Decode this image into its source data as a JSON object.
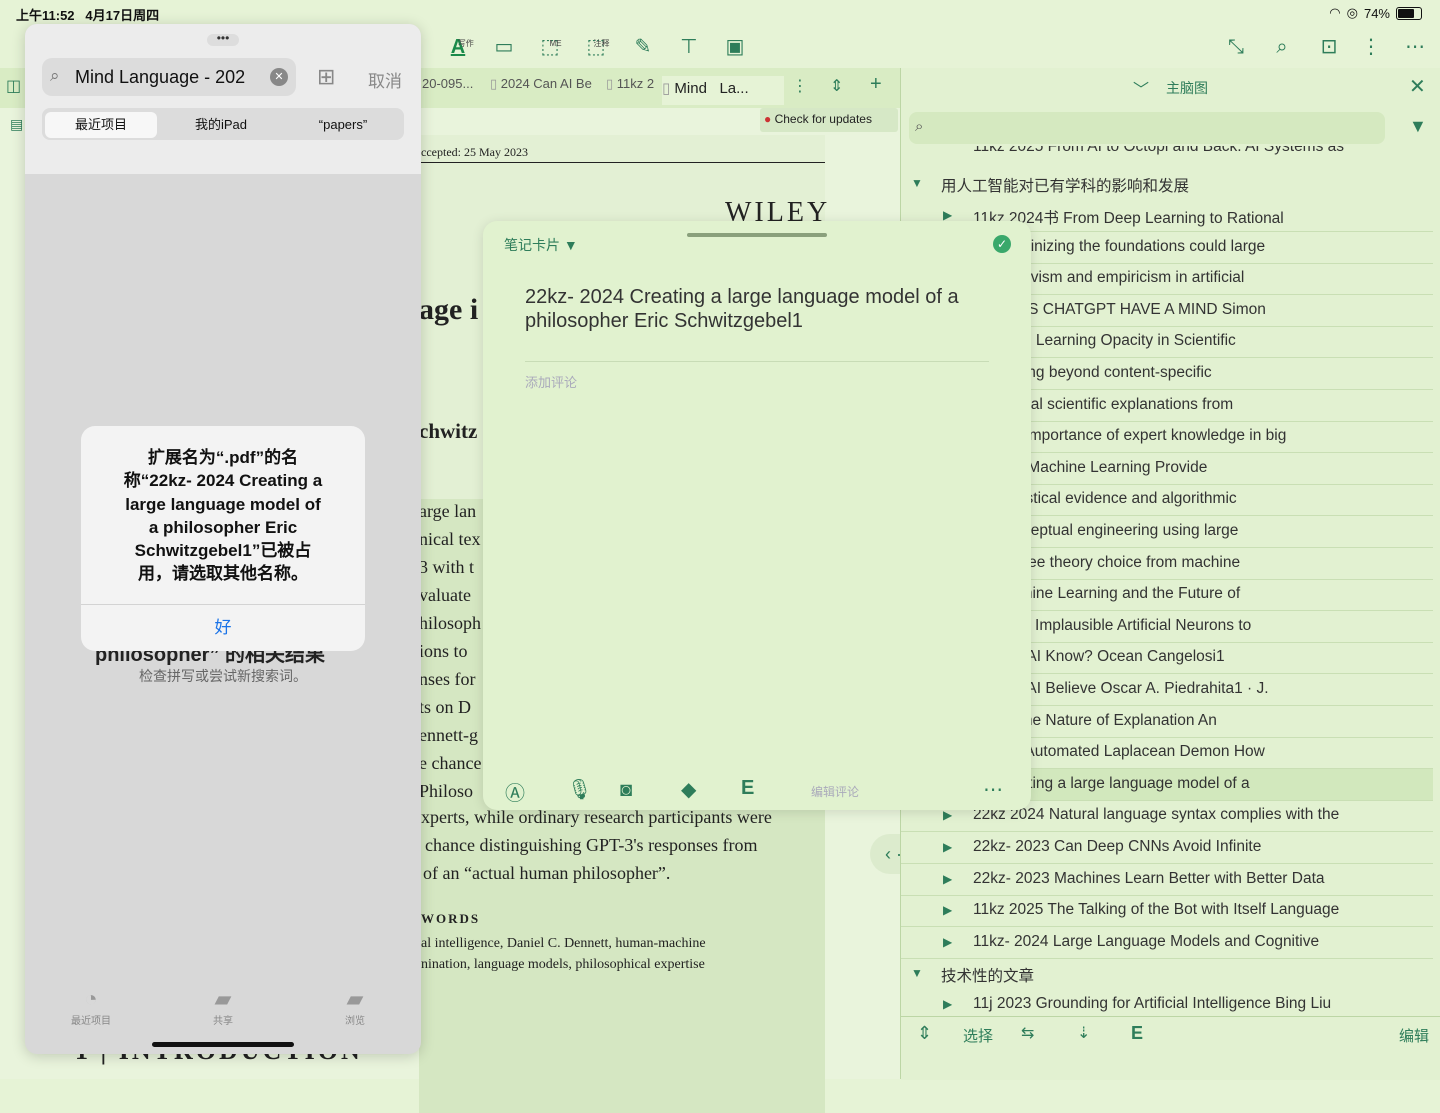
{
  "status": {
    "time": "上午11:52",
    "date": "4月17日周四",
    "battery": "74%"
  },
  "toolbar": {
    "cap_a": "写作",
    "cap_me": "ME",
    "cap_note": "注释"
  },
  "tabs": {
    "t1": "20-095...",
    "t2": "2024 Can AI Be",
    "t3": "11kz 2",
    "t4": "Mind",
    "t5": "La..."
  },
  "doc": {
    "check_updates": "Check for updates",
    "accepted": "ccepted: 25 May 2023",
    "wiley": "WILEY",
    "title_frag": "age i",
    "author_frag": "chwitz",
    "lines": [
      "arge lan",
      "nical tex",
      "3 with t",
      "valuate",
      "hilosoph",
      "ions to",
      "nses for",
      "ts on D",
      "ennett-g",
      "e chance",
      "Philoso"
    ],
    "para1": "xperts, while ordinary research participants were",
    "para2": "chance distinguishing GPT-3's responses from",
    "para3": "of an “actual human philosopher”.",
    "keywords_head": "WORDS",
    "kw1": "al intelligence, Daniel C. Dennett, human-machine",
    "kw2": "nination, language models, philosophical expertise",
    "intro": "1 | INTRODUCTION"
  },
  "notecard": {
    "label": "笔记卡片 ▼",
    "title": "22kz- 2024 Creating a large language model of a philosopher Eric Schwitzgebel1",
    "comment_placeholder": "添加评论",
    "edit_comment": "编辑评论"
  },
  "outline": {
    "header": "主脑图",
    "top_clip": "11kz 2025 From AI to Octopi and Back. AI Systems as",
    "group1": "用人工智能对已有学科的影响和发展",
    "rows": [
      "11kz 2024书 From Deep Learning to Rational",
      "24 Scrutinizing the foundations could large",
      "024 Nativism and empiricism in artificial",
      "24 DOES CHATGPT HAVE A MIND Simon",
      "23 Deep Learning Opacity in Scientific",
      "23 Moving beyond content-specific",
      "23 Causal scientific explanations from",
      "23 The importance of expert knowledge in big",
      "23 Can Machine Learning Provide",
      "23 Statistical evidence and algorithmic",
      "23 Conceptual engineering using large",
      "22 No free theory choice from machine",
      "21 Machine Learning and the Future of",
      "20 From Implausible Artificial Neurons to",
      "24 Can AI Know? Ocean Cangelosi1",
      "24 Can AI Believe Oscar A. Piedrahita1 · J.",
      "24 On the Nature of Explanation An",
      "22 The Automated Laplacean Demon How",
      "24 Creating a large language model of a",
      "22kz 2024 Natural language syntax complies with the",
      "22kz- 2023 Can Deep CNNs Avoid Infinite",
      "22kz- 2023 Machines Learn Better with Better Data",
      "11kz 2025 The Talking of the Bot with Itself Language",
      "11kz- 2024 Large Language Models and Cognitive"
    ],
    "group2": "技术性的文章",
    "last_row": "11j 2023 Grounding for Artificial Intelligence Bing Liu",
    "bottom_select": "选择",
    "bottom_edit": "编辑"
  },
  "picker": {
    "search_value": "Mind  Language - 202",
    "cancel": "取消",
    "seg": [
      "最近项目",
      "我的iPad",
      "“papers”"
    ],
    "no_result_frag": "philosopher” 的相关结果",
    "hint": "检查拼写或尝试新搜索词。",
    "tabbar": [
      "最近项目",
      "共享",
      "浏览"
    ]
  },
  "alert": {
    "message": "扩展名为“.pdf”的名称“22kz- 2024 Creating a large language model of a philosopher Eric Schwitzgebel1”已被占用，请选取其他名称。",
    "ok": "好"
  },
  "colors": {
    "accent": "#2e7d5a",
    "bg": "#e6f3d6",
    "ios_blue": "#1a73e8"
  }
}
